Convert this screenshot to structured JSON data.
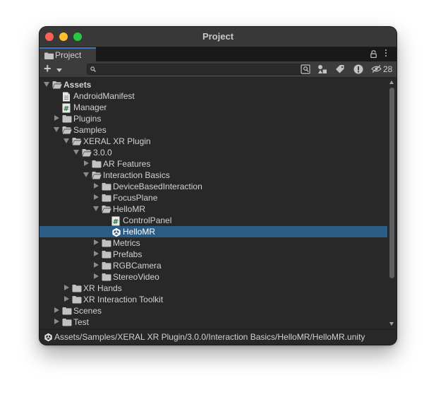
{
  "window": {
    "title": "Project"
  },
  "tab": {
    "label": "Project",
    "icon": "folder-icon"
  },
  "toolbar": {
    "add_label": "+",
    "search_value": "",
    "buttons": [
      "search-by-type-icon",
      "shapes-icon",
      "label-tag-icon",
      "warning-icon"
    ],
    "hidden_count": "28"
  },
  "tree": {
    "rows": [
      {
        "label": "Assets",
        "icon": "folder-open-icon",
        "arrow": "expanded",
        "depth": 0,
        "bold": true
      },
      {
        "label": "AndroidManifest",
        "icon": "document-icon",
        "arrow": "none",
        "depth": 1
      },
      {
        "label": "Manager",
        "icon": "csharp-script-icon",
        "arrow": "none",
        "depth": 1
      },
      {
        "label": "Plugins",
        "icon": "folder-icon",
        "arrow": "collapsed",
        "depth": 1
      },
      {
        "label": "Samples",
        "icon": "folder-open-icon",
        "arrow": "expanded",
        "depth": 1
      },
      {
        "label": "XERAL XR Plugin",
        "icon": "folder-open-icon",
        "arrow": "expanded",
        "depth": 2
      },
      {
        "label": "3.0.0",
        "icon": "folder-open-icon",
        "arrow": "expanded",
        "depth": 3
      },
      {
        "label": "AR Features",
        "icon": "folder-icon",
        "arrow": "collapsed",
        "depth": 4
      },
      {
        "label": "Interaction Basics",
        "icon": "folder-open-icon",
        "arrow": "expanded",
        "depth": 4
      },
      {
        "label": "DeviceBasedInteraction",
        "icon": "folder-icon",
        "arrow": "collapsed",
        "depth": 5
      },
      {
        "label": "FocusPlane",
        "icon": "folder-icon",
        "arrow": "collapsed",
        "depth": 5
      },
      {
        "label": "HelloMR",
        "icon": "folder-open-icon",
        "arrow": "expanded",
        "depth": 5
      },
      {
        "label": "ControlPanel",
        "icon": "csharp-script-icon",
        "arrow": "none",
        "depth": 6
      },
      {
        "label": "HelloMR",
        "icon": "unity-scene-icon",
        "arrow": "none",
        "depth": 6,
        "selected": true
      },
      {
        "label": "Metrics",
        "icon": "folder-icon",
        "arrow": "collapsed",
        "depth": 5
      },
      {
        "label": "Prefabs",
        "icon": "folder-icon",
        "arrow": "collapsed",
        "depth": 5
      },
      {
        "label": "RGBCamera",
        "icon": "folder-icon",
        "arrow": "collapsed",
        "depth": 5
      },
      {
        "label": "StereoVideo",
        "icon": "folder-icon",
        "arrow": "collapsed",
        "depth": 5
      },
      {
        "label": "XR Hands",
        "icon": "folder-icon",
        "arrow": "collapsed",
        "depth": 2
      },
      {
        "label": "XR Interaction Toolkit",
        "icon": "folder-icon",
        "arrow": "collapsed",
        "depth": 2
      },
      {
        "label": "Scenes",
        "icon": "folder-icon",
        "arrow": "collapsed",
        "depth": 1
      },
      {
        "label": "Test",
        "icon": "folder-icon",
        "arrow": "collapsed",
        "depth": 1
      }
    ]
  },
  "status": {
    "path": "Assets/Samples/XERAL XR Plugin/3.0.0/Interaction Basics/HelloMR/HelloMR.unity"
  },
  "colors": {
    "selection": "#2c5d87",
    "tab_accent": "#3a79bb",
    "background": "#282828"
  }
}
